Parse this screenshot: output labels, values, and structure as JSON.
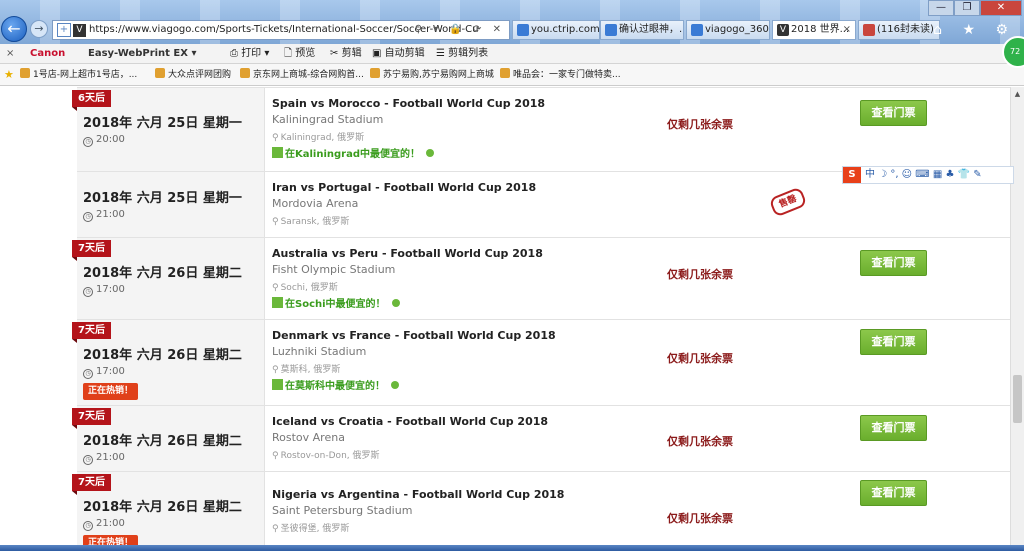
{
  "browser": {
    "url": "https://www.viagogo.com/Sports-Tickets/International-Soccer/Soccer-World-Cu",
    "addr_favicon": "V",
    "addr_controls": "⚲ ▾ 🔒 ⟳ ✕",
    "tabs": [
      {
        "label": "you.ctrip.com",
        "icon_color": "#3a7bd5",
        "icon": ""
      },
      {
        "label": "确认过眼神，...",
        "icon_color": "#3a7bd5",
        "icon": ""
      },
      {
        "label": "viagogo_360...",
        "icon_color": "#3a7bd5",
        "icon": ""
      },
      {
        "label": "2018 世界...",
        "icon_color": "#333333",
        "icon": "V"
      },
      {
        "label": "(116封未读)",
        "icon_color": "#c9463d",
        "icon": ""
      }
    ],
    "win_controls": [
      "—",
      "❐",
      "✕"
    ],
    "nav_icons": "⌂ ★ ⚙"
  },
  "toolbar": {
    "close": "×",
    "brand": "Canon",
    "product": "Easy-WebPrint EX",
    "print": "打印",
    "preview": "预览",
    "clip": "剪辑",
    "auto_clip": "自动剪辑",
    "clip_list": "剪辑列表"
  },
  "favorites": [
    "1号店-网上超市1号店，...",
    "大众点评网团购",
    "京东网上商城-综合网购首...",
    "苏宁易购,苏宁易购网上商城",
    "唯品会：一家专门做特卖..."
  ],
  "green_circle": "72",
  "ime": {
    "logo": "S",
    "items": "中 ☽ °, ☺ ⌨ ▦ ♣ 👕 ✎"
  },
  "events": [
    {
      "badge": "6天后",
      "date": "2018年 六月 25日 星期一",
      "time": "20:00",
      "hot": "",
      "match": "Spain vs Morocco - Football World Cup 2018",
      "venue": "Kaliningrad Stadium",
      "location": "Kaliningrad, 俄罗斯",
      "cheap": "在Kaliningrad中最便宜的！",
      "left": "仅剩几张余票",
      "sold_out": "",
      "button": "查看门票"
    },
    {
      "badge": "",
      "date": "2018年 六月 25日 星期一",
      "time": "21:00",
      "hot": "",
      "match": "Iran vs Portugal - Football World Cup 2018",
      "venue": "Mordovia Arena",
      "location": "Saransk, 俄罗斯",
      "cheap": "",
      "left": "",
      "sold_out": "售罄",
      "button": ""
    },
    {
      "badge": "7天后",
      "date": "2018年 六月 26日 星期二",
      "time": "17:00",
      "hot": "",
      "match": "Australia vs Peru - Football World Cup 2018",
      "venue": "Fisht Olympic Stadium",
      "location": "Sochi, 俄罗斯",
      "cheap": "在Sochi中最便宜的！",
      "left": "仅剩几张余票",
      "sold_out": "",
      "button": "查看门票"
    },
    {
      "badge": "7天后",
      "date": "2018年 六月 26日 星期二",
      "time": "17:00",
      "hot": "正在热销！",
      "match": "Denmark vs France - Football World Cup 2018",
      "venue": "Luzhniki Stadium",
      "location": "莫斯科, 俄罗斯",
      "cheap": "在莫斯科中最便宜的！",
      "left": "仅剩几张余票",
      "sold_out": "",
      "button": "查看门票"
    },
    {
      "badge": "7天后",
      "date": "2018年 六月 26日 星期二",
      "time": "21:00",
      "hot": "",
      "match": "Iceland vs Croatia - Football World Cup 2018",
      "venue": "Rostov Arena",
      "location": "Rostov-on-Don, 俄罗斯",
      "cheap": "",
      "left": "仅剩几张余票",
      "sold_out": "",
      "button": "查看门票"
    },
    {
      "badge": "7天后",
      "date": "2018年 六月 26日 星期二",
      "time": "21:00",
      "hot": "正在热销！",
      "match": "Nigeria vs Argentina - Football World Cup 2018",
      "venue": "Saint Petersburg Stadium",
      "location": "圣彼得堡, 俄罗斯",
      "cheap": "",
      "left": "仅剩几张余票",
      "sold_out": "",
      "button": "查看门票"
    }
  ]
}
